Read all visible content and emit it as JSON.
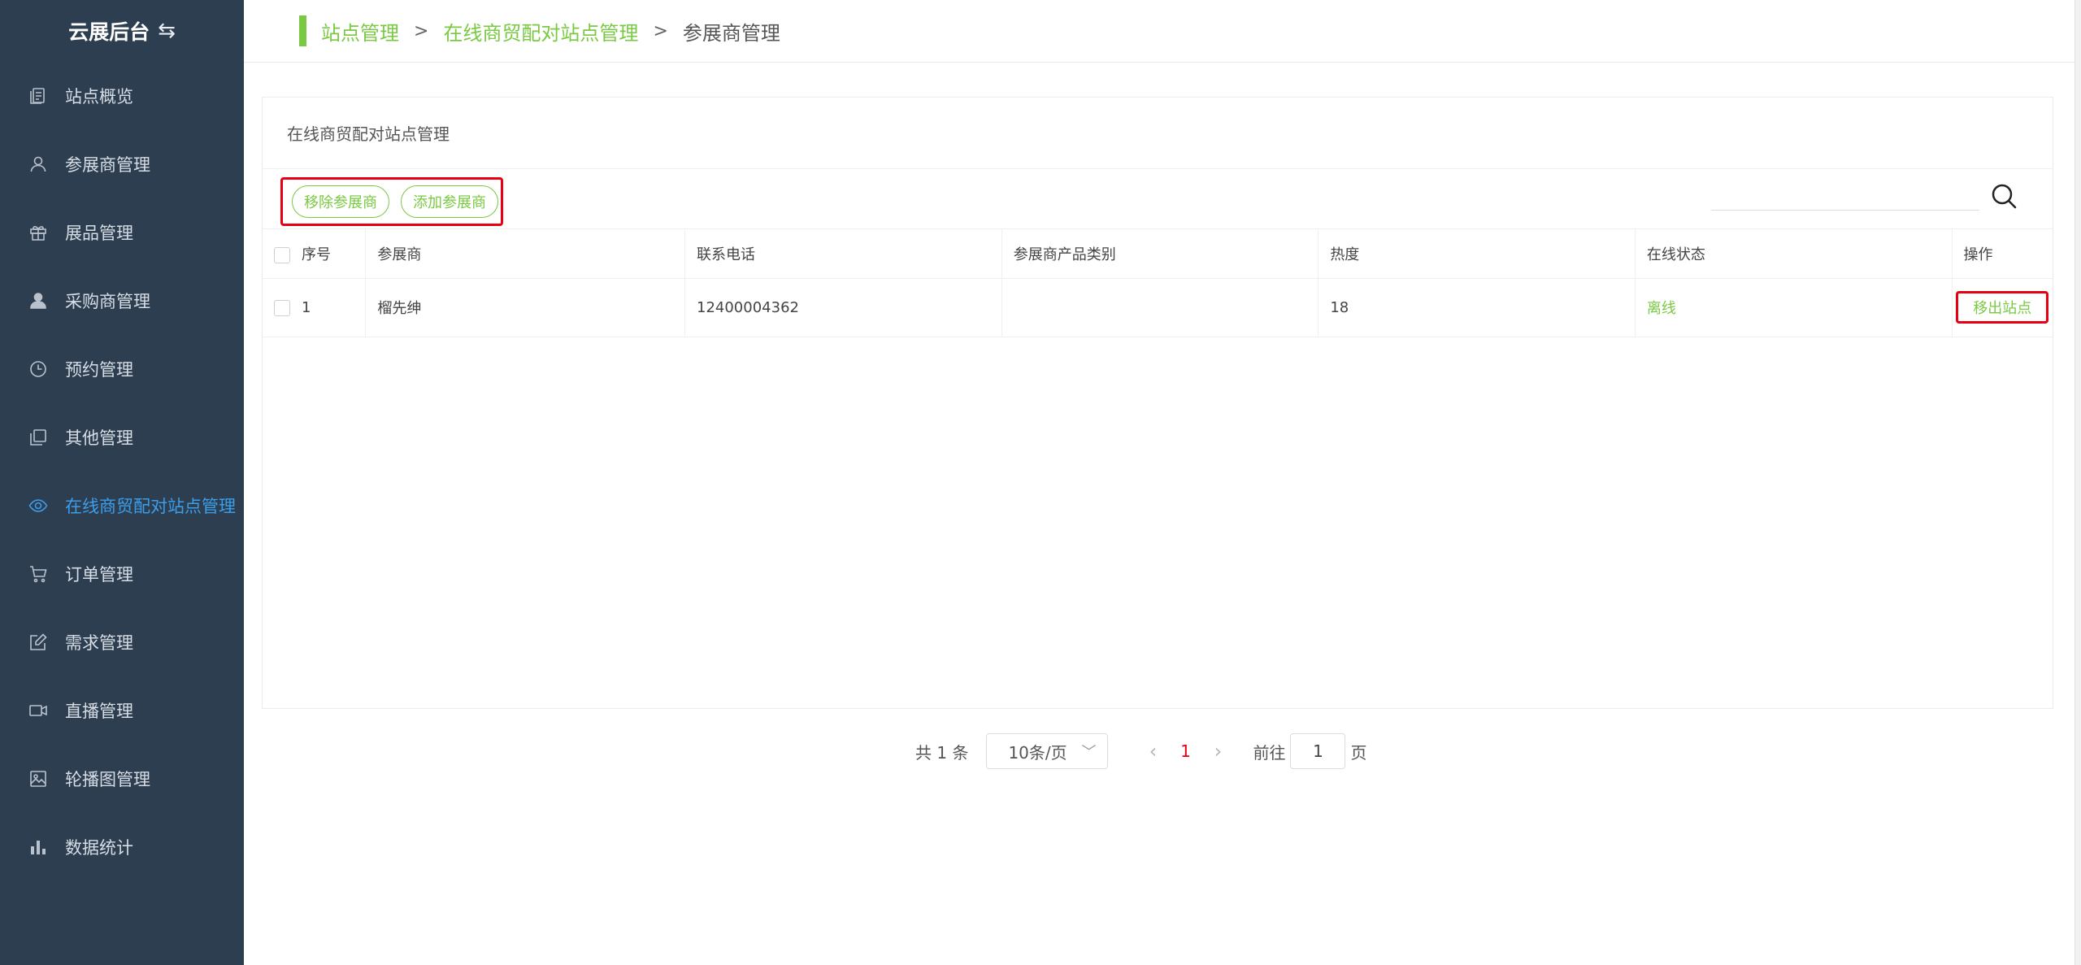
{
  "app": {
    "title": "云展后台",
    "switch_icon": "swap-arrows-icon"
  },
  "sidebar": {
    "items": [
      {
        "label": "站点概览",
        "icon": "document-list-icon",
        "active": false
      },
      {
        "label": "参展商管理",
        "icon": "user-outline-icon",
        "active": false
      },
      {
        "label": "展品管理",
        "icon": "gift-box-icon",
        "active": false
      },
      {
        "label": "采购商管理",
        "icon": "user-filled-icon",
        "active": false
      },
      {
        "label": "预约管理",
        "icon": "clock-icon",
        "active": false
      },
      {
        "label": "其他管理",
        "icon": "copy-icon",
        "active": false
      },
      {
        "label": "在线商贸配对站点管理",
        "icon": "eye-icon",
        "active": true
      },
      {
        "label": "订单管理",
        "icon": "cart-icon",
        "active": false
      },
      {
        "label": "需求管理",
        "icon": "edit-icon",
        "active": false
      },
      {
        "label": "直播管理",
        "icon": "video-camera-icon",
        "active": false
      },
      {
        "label": "轮播图管理",
        "icon": "picture-icon",
        "active": false
      },
      {
        "label": "数据统计",
        "icon": "bar-chart-icon",
        "active": false
      }
    ]
  },
  "breadcrumb": {
    "items": [
      "站点管理",
      "在线商贸配对站点管理",
      "参展商管理"
    ],
    "separator": ">"
  },
  "card": {
    "title": "在线商贸配对站点管理",
    "toolbar": {
      "remove_label": "移除参展商",
      "add_label": "添加参展商",
      "search_value": ""
    },
    "table": {
      "columns": [
        "序号",
        "参展商",
        "联系电话",
        "参展商产品类别",
        "热度",
        "在线状态",
        "操作"
      ],
      "rows": [
        {
          "index": "1",
          "exhibitor": "榴先绅",
          "phone": "12400004362",
          "category": "",
          "heat": "18",
          "status": "离线",
          "action": "移出站点"
        }
      ]
    }
  },
  "pagination": {
    "total_text": "共 1 条",
    "page_size": "10条/页",
    "current_page": "1",
    "goto_label": "前往",
    "goto_value": "1",
    "page_suffix": "页"
  },
  "colors": {
    "sidebar_bg": "#2e3e51",
    "accent_green": "#7ac943",
    "active_blue": "#3b9eea",
    "highlight_red": "#e60012"
  }
}
